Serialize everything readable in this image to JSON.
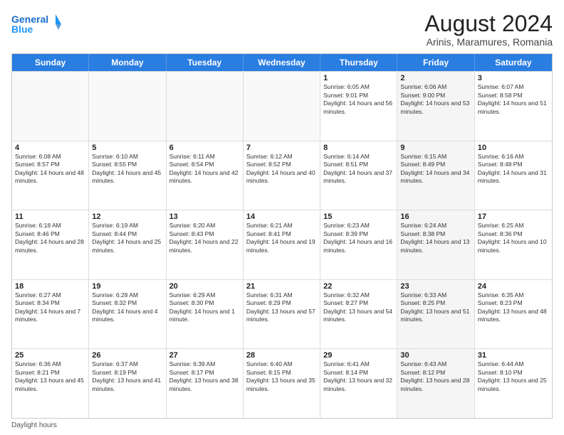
{
  "header": {
    "logo_line1": "General",
    "logo_line2": "Blue",
    "month_year": "August 2024",
    "location": "Arinis, Maramures, Romania"
  },
  "calendar": {
    "weekdays": [
      "Sunday",
      "Monday",
      "Tuesday",
      "Wednesday",
      "Thursday",
      "Friday",
      "Saturday"
    ],
    "rows": [
      [
        {
          "day": "",
          "sunrise": "",
          "sunset": "",
          "daylight": "",
          "shaded": false
        },
        {
          "day": "",
          "sunrise": "",
          "sunset": "",
          "daylight": "",
          "shaded": false
        },
        {
          "day": "",
          "sunrise": "",
          "sunset": "",
          "daylight": "",
          "shaded": false
        },
        {
          "day": "",
          "sunrise": "",
          "sunset": "",
          "daylight": "",
          "shaded": false
        },
        {
          "day": "1",
          "sunrise": "Sunrise: 6:05 AM",
          "sunset": "Sunset: 9:01 PM",
          "daylight": "Daylight: 14 hours and 56 minutes.",
          "shaded": false
        },
        {
          "day": "2",
          "sunrise": "Sunrise: 6:06 AM",
          "sunset": "Sunset: 9:00 PM",
          "daylight": "Daylight: 14 hours and 53 minutes.",
          "shaded": true
        },
        {
          "day": "3",
          "sunrise": "Sunrise: 6:07 AM",
          "sunset": "Sunset: 8:58 PM",
          "daylight": "Daylight: 14 hours and 51 minutes.",
          "shaded": false
        }
      ],
      [
        {
          "day": "4",
          "sunrise": "Sunrise: 6:08 AM",
          "sunset": "Sunset: 8:57 PM",
          "daylight": "Daylight: 14 hours and 48 minutes.",
          "shaded": false
        },
        {
          "day": "5",
          "sunrise": "Sunrise: 6:10 AM",
          "sunset": "Sunset: 8:55 PM",
          "daylight": "Daylight: 14 hours and 45 minutes.",
          "shaded": false
        },
        {
          "day": "6",
          "sunrise": "Sunrise: 6:11 AM",
          "sunset": "Sunset: 8:54 PM",
          "daylight": "Daylight: 14 hours and 42 minutes.",
          "shaded": false
        },
        {
          "day": "7",
          "sunrise": "Sunrise: 6:12 AM",
          "sunset": "Sunset: 8:52 PM",
          "daylight": "Daylight: 14 hours and 40 minutes.",
          "shaded": false
        },
        {
          "day": "8",
          "sunrise": "Sunrise: 6:14 AM",
          "sunset": "Sunset: 8:51 PM",
          "daylight": "Daylight: 14 hours and 37 minutes.",
          "shaded": false
        },
        {
          "day": "9",
          "sunrise": "Sunrise: 6:15 AM",
          "sunset": "Sunset: 8:49 PM",
          "daylight": "Daylight: 14 hours and 34 minutes.",
          "shaded": true
        },
        {
          "day": "10",
          "sunrise": "Sunrise: 6:16 AM",
          "sunset": "Sunset: 8:48 PM",
          "daylight": "Daylight: 14 hours and 31 minutes.",
          "shaded": false
        }
      ],
      [
        {
          "day": "11",
          "sunrise": "Sunrise: 6:18 AM",
          "sunset": "Sunset: 8:46 PM",
          "daylight": "Daylight: 14 hours and 28 minutes.",
          "shaded": false
        },
        {
          "day": "12",
          "sunrise": "Sunrise: 6:19 AM",
          "sunset": "Sunset: 8:44 PM",
          "daylight": "Daylight: 14 hours and 25 minutes.",
          "shaded": false
        },
        {
          "day": "13",
          "sunrise": "Sunrise: 6:20 AM",
          "sunset": "Sunset: 8:43 PM",
          "daylight": "Daylight: 14 hours and 22 minutes.",
          "shaded": false
        },
        {
          "day": "14",
          "sunrise": "Sunrise: 6:21 AM",
          "sunset": "Sunset: 8:41 PM",
          "daylight": "Daylight: 14 hours and 19 minutes.",
          "shaded": false
        },
        {
          "day": "15",
          "sunrise": "Sunrise: 6:23 AM",
          "sunset": "Sunset: 8:39 PM",
          "daylight": "Daylight: 14 hours and 16 minutes.",
          "shaded": false
        },
        {
          "day": "16",
          "sunrise": "Sunrise: 6:24 AM",
          "sunset": "Sunset: 8:38 PM",
          "daylight": "Daylight: 14 hours and 13 minutes.",
          "shaded": true
        },
        {
          "day": "17",
          "sunrise": "Sunrise: 6:25 AM",
          "sunset": "Sunset: 8:36 PM",
          "daylight": "Daylight: 14 hours and 10 minutes.",
          "shaded": false
        }
      ],
      [
        {
          "day": "18",
          "sunrise": "Sunrise: 6:27 AM",
          "sunset": "Sunset: 8:34 PM",
          "daylight": "Daylight: 14 hours and 7 minutes.",
          "shaded": false
        },
        {
          "day": "19",
          "sunrise": "Sunrise: 6:28 AM",
          "sunset": "Sunset: 8:32 PM",
          "daylight": "Daylight: 14 hours and 4 minutes.",
          "shaded": false
        },
        {
          "day": "20",
          "sunrise": "Sunrise: 6:29 AM",
          "sunset": "Sunset: 8:30 PM",
          "daylight": "Daylight: 14 hours and 1 minute.",
          "shaded": false
        },
        {
          "day": "21",
          "sunrise": "Sunrise: 6:31 AM",
          "sunset": "Sunset: 8:29 PM",
          "daylight": "Daylight: 13 hours and 57 minutes.",
          "shaded": false
        },
        {
          "day": "22",
          "sunrise": "Sunrise: 6:32 AM",
          "sunset": "Sunset: 8:27 PM",
          "daylight": "Daylight: 13 hours and 54 minutes.",
          "shaded": false
        },
        {
          "day": "23",
          "sunrise": "Sunrise: 6:33 AM",
          "sunset": "Sunset: 8:25 PM",
          "daylight": "Daylight: 13 hours and 51 minutes.",
          "shaded": true
        },
        {
          "day": "24",
          "sunrise": "Sunrise: 6:35 AM",
          "sunset": "Sunset: 8:23 PM",
          "daylight": "Daylight: 13 hours and 48 minutes.",
          "shaded": false
        }
      ],
      [
        {
          "day": "25",
          "sunrise": "Sunrise: 6:36 AM",
          "sunset": "Sunset: 8:21 PM",
          "daylight": "Daylight: 13 hours and 45 minutes.",
          "shaded": false
        },
        {
          "day": "26",
          "sunrise": "Sunrise: 6:37 AM",
          "sunset": "Sunset: 8:19 PM",
          "daylight": "Daylight: 13 hours and 41 minutes.",
          "shaded": false
        },
        {
          "day": "27",
          "sunrise": "Sunrise: 6:39 AM",
          "sunset": "Sunset: 8:17 PM",
          "daylight": "Daylight: 13 hours and 38 minutes.",
          "shaded": false
        },
        {
          "day": "28",
          "sunrise": "Sunrise: 6:40 AM",
          "sunset": "Sunset: 8:15 PM",
          "daylight": "Daylight: 13 hours and 35 minutes.",
          "shaded": false
        },
        {
          "day": "29",
          "sunrise": "Sunrise: 6:41 AM",
          "sunset": "Sunset: 8:14 PM",
          "daylight": "Daylight: 13 hours and 32 minutes.",
          "shaded": false
        },
        {
          "day": "30",
          "sunrise": "Sunrise: 6:43 AM",
          "sunset": "Sunset: 8:12 PM",
          "daylight": "Daylight: 13 hours and 28 minutes.",
          "shaded": true
        },
        {
          "day": "31",
          "sunrise": "Sunrise: 6:44 AM",
          "sunset": "Sunset: 8:10 PM",
          "daylight": "Daylight: 13 hours and 25 minutes.",
          "shaded": false
        }
      ]
    ]
  },
  "footer": {
    "note": "Daylight hours"
  }
}
